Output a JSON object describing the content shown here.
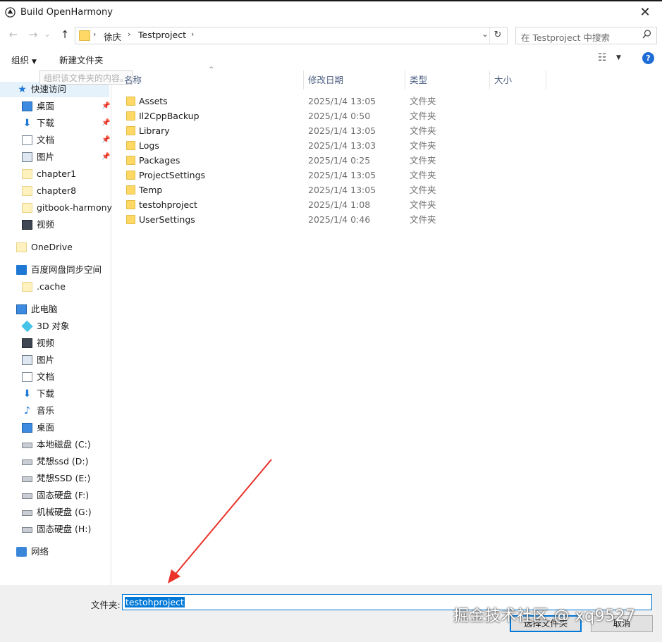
{
  "window": {
    "title": "Build OpenHarmony",
    "close": "✕"
  },
  "nav": {
    "back": "←",
    "forward": "→",
    "recent": "⌄",
    "up": "↑",
    "breadcrumbs": [
      "徐庆",
      "Testproject"
    ],
    "refresh": "↻",
    "search_placeholder": "在 Testproject 中搜索"
  },
  "toolbar": {
    "organize": "组织",
    "new_folder": "新建文件夹",
    "help": "?"
  },
  "tooltip": "组织该文件夹的内容。",
  "sidebar": {
    "quick_access": "快速访问",
    "quick_items": [
      {
        "label": "桌面",
        "icon": "desktop-icon",
        "pinned": true
      },
      {
        "label": "下载",
        "icon": "download-icon",
        "pinned": true
      },
      {
        "label": "文档",
        "icon": "document-icon",
        "pinned": true
      },
      {
        "label": "图片",
        "icon": "picture-icon",
        "pinned": true
      },
      {
        "label": "chapter1",
        "icon": "folder-icon",
        "pinned": false
      },
      {
        "label": "chapter8",
        "icon": "folder-icon",
        "pinned": false
      },
      {
        "label": "gitbook-harmony",
        "icon": "folder-icon",
        "pinned": false
      },
      {
        "label": "视频",
        "icon": "video-icon",
        "pinned": false
      }
    ],
    "onedrive": "OneDrive",
    "baidu": "百度网盘同步空间",
    "baidu_child": ".cache",
    "this_pc": "此电脑",
    "pc_items": [
      {
        "label": "3D 对象",
        "icon": "3d-objects-icon"
      },
      {
        "label": "视频",
        "icon": "video-icon"
      },
      {
        "label": "图片",
        "icon": "picture-icon"
      },
      {
        "label": "文档",
        "icon": "document-icon"
      },
      {
        "label": "下载",
        "icon": "download-icon"
      },
      {
        "label": "音乐",
        "icon": "music-icon"
      },
      {
        "label": "桌面",
        "icon": "desktop-icon"
      },
      {
        "label": "本地磁盘 (C:)",
        "icon": "system-drive-icon"
      },
      {
        "label": "梵想ssd (D:)",
        "icon": "drive-icon"
      },
      {
        "label": "梵想SSD (E:)",
        "icon": "drive-icon"
      },
      {
        "label": "固态硬盘 (F:)",
        "icon": "drive-icon"
      },
      {
        "label": "机械硬盘 (G:)",
        "icon": "drive-icon"
      },
      {
        "label": "固态硬盘 (H:)",
        "icon": "drive-icon"
      }
    ],
    "network": "网络"
  },
  "columns": {
    "name": "名称",
    "date": "修改日期",
    "type": "类型",
    "size": "大小"
  },
  "files": [
    {
      "name": "Assets",
      "date": "2025/1/4 13:05",
      "type": "文件夹"
    },
    {
      "name": "Il2CppBackup",
      "date": "2025/1/4 0:50",
      "type": "文件夹"
    },
    {
      "name": "Library",
      "date": "2025/1/4 13:05",
      "type": "文件夹"
    },
    {
      "name": "Logs",
      "date": "2025/1/4 13:03",
      "type": "文件夹"
    },
    {
      "name": "Packages",
      "date": "2025/1/4 0:25",
      "type": "文件夹"
    },
    {
      "name": "ProjectSettings",
      "date": "2025/1/4 13:05",
      "type": "文件夹"
    },
    {
      "name": "Temp",
      "date": "2025/1/4 13:05",
      "type": "文件夹"
    },
    {
      "name": "testohproject",
      "date": "2025/1/4 1:08",
      "type": "文件夹"
    },
    {
      "name": "UserSettings",
      "date": "2025/1/4 0:46",
      "type": "文件夹"
    }
  ],
  "footer": {
    "folder_label": "文件夹:",
    "folder_value": "testohproject",
    "select_button": "选择文件夹",
    "cancel_button": "取消"
  },
  "watermark": "掘金技术社区 @ xq9527",
  "colors": {
    "accent": "#0078d7",
    "arrow": "#e8322a",
    "folder": "#ffd865"
  }
}
